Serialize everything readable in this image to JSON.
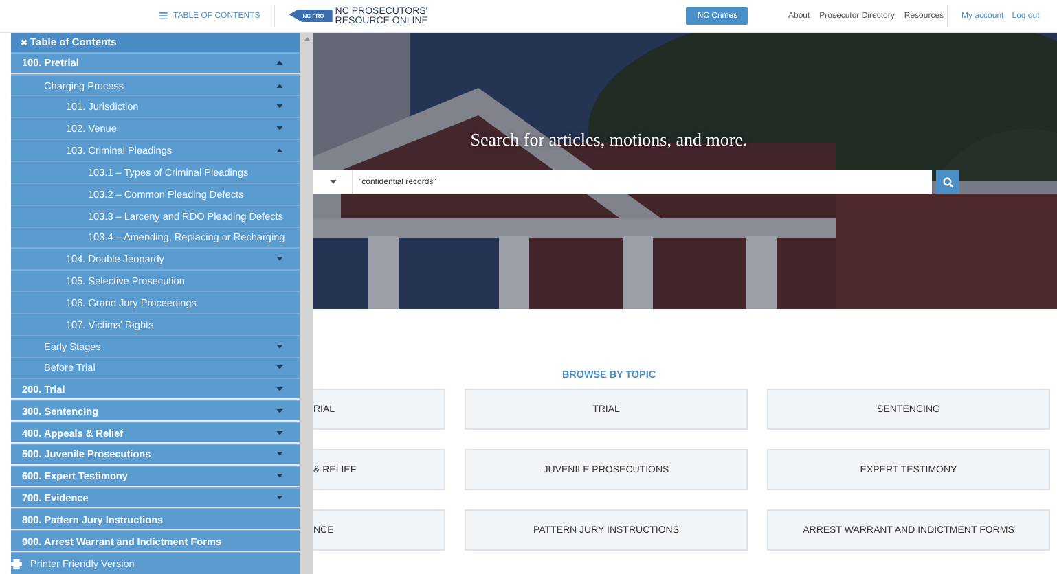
{
  "header": {
    "toc_link": "TABLE OF CONTENTS",
    "logo_badge": "NC PRO",
    "logo_title": [
      "NC PROSECUTORS'",
      "RESOURCE ONLINE"
    ],
    "primary_button": "NC Crimes",
    "nav": [
      "About",
      "Prosecutor Directory",
      "Resources"
    ],
    "account": [
      "My account",
      "Log out"
    ]
  },
  "sidebar": {
    "close": "✖",
    "title": "Table of Contents",
    "items": [
      {
        "label": "100. Pretrial",
        "expanded": true,
        "children": [
          {
            "label": "Charging Process",
            "expanded": true,
            "children": [
              {
                "label": "101. Jurisdiction",
                "expanded": false
              },
              {
                "label": "102. Venue",
                "expanded": false
              },
              {
                "label": "103. Criminal Pleadings",
                "expanded": true,
                "children": [
                  {
                    "label": "103.1 – Types of Criminal Pleadings"
                  },
                  {
                    "label": "103.2 – Common Pleading Defects"
                  },
                  {
                    "label": "103.3 – Larceny and RDO Pleading Defects"
                  },
                  {
                    "label": "103.4 – Amending, Replacing or Recharging"
                  }
                ]
              },
              {
                "label": "104. Double Jeopardy",
                "expanded": false
              },
              {
                "label": "105. Selective Prosecution"
              },
              {
                "label": "106. Grand Jury Proceedings"
              },
              {
                "label": "107. Victims' Rights"
              }
            ]
          },
          {
            "label": "Early Stages",
            "expanded": false
          },
          {
            "label": "Before Trial",
            "expanded": false
          }
        ]
      },
      {
        "label": "200. Trial",
        "expanded": false
      },
      {
        "label": "300. Sentencing",
        "expanded": false
      },
      {
        "label": "400. Appeals & Relief",
        "expanded": false
      },
      {
        "label": "500. Juvenile Prosecutions",
        "expanded": false
      },
      {
        "label": "600. Expert Testimony",
        "expanded": false
      },
      {
        "label": "700. Evidence",
        "expanded": false
      },
      {
        "label": "800. Pattern Jury Instructions"
      },
      {
        "label": "900. Arrest Warrant and Indictment Forms"
      }
    ],
    "printer": "Printer Friendly Version"
  },
  "hero": {
    "heading": "Search for articles, motions, and more.",
    "search": {
      "value": "\"confidential records\""
    }
  },
  "browse": {
    "title": "BROWSE BY TOPIC",
    "topics": [
      "RIAL",
      "TRIAL",
      "SENTENCING",
      "& RELIEF",
      "JUVENILE PROSECUTIONS",
      "EXPERT TESTIMONY",
      "NCE",
      "PATTERN JURY INSTRUCTIONS",
      "ARREST WARRANT AND INDICTMENT FORMS"
    ]
  }
}
